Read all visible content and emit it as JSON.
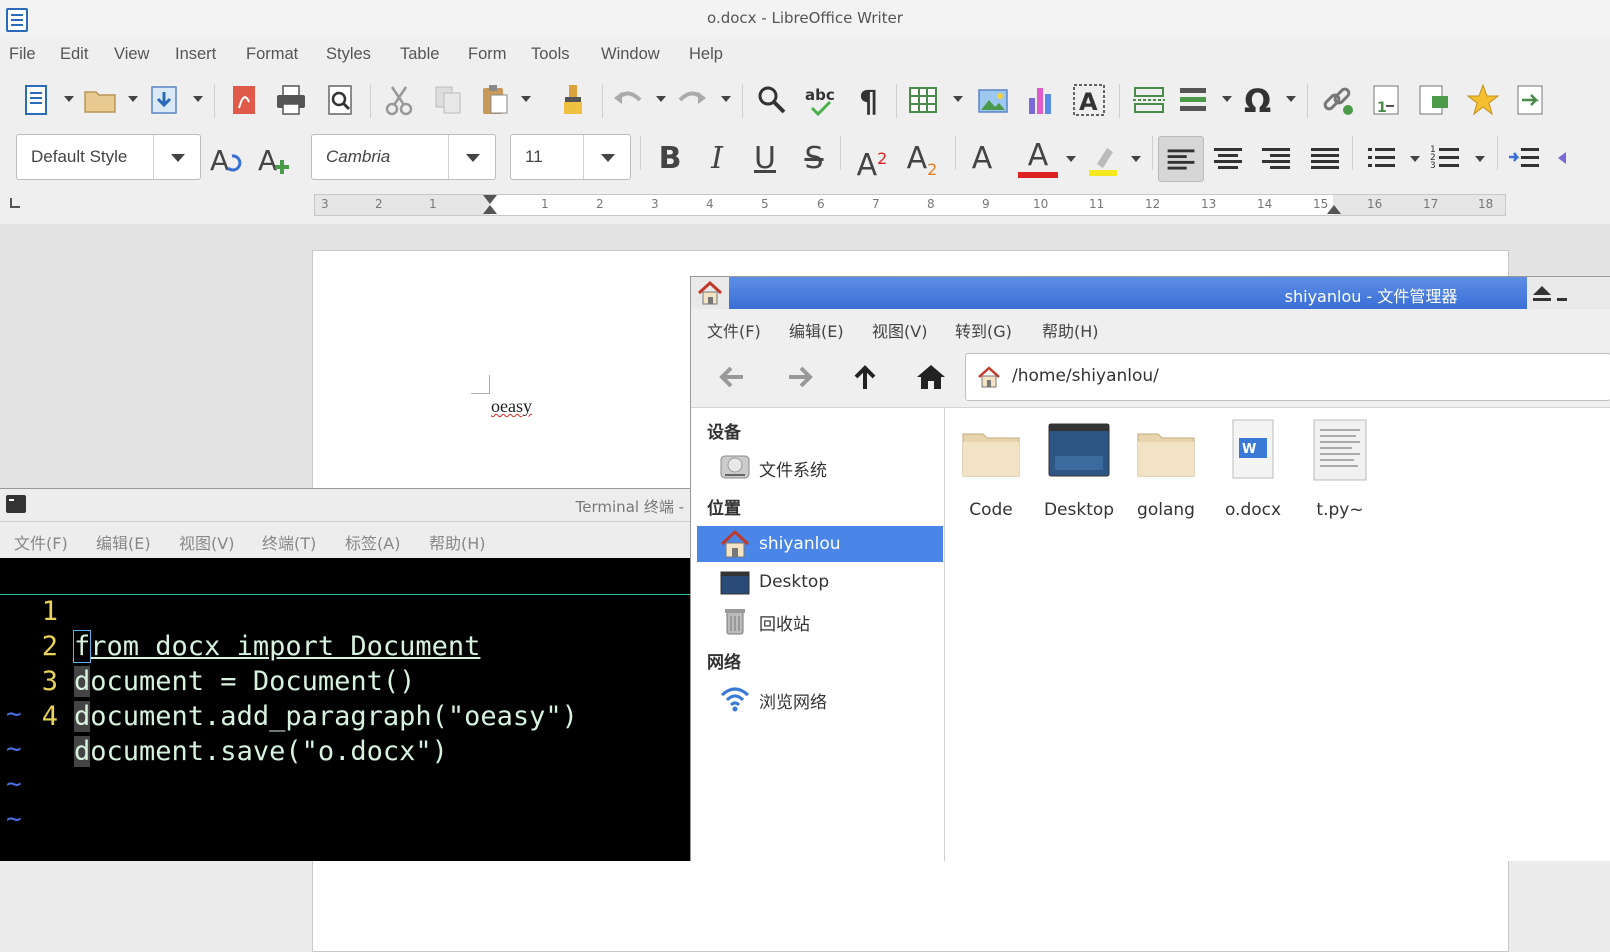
{
  "writer": {
    "title": "o.docx - LibreOffice Writer",
    "menu": [
      "File",
      "Edit",
      "View",
      "Insert",
      "Format",
      "Styles",
      "Table",
      "Form",
      "Tools",
      "Window",
      "Help"
    ],
    "paragraph_style": "Default Style",
    "font_name": "Cambria",
    "font_size": "11",
    "ruler_ticks": [
      "3",
      "2",
      "1",
      "1",
      "2",
      "3",
      "4",
      "5",
      "6",
      "7",
      "8",
      "9",
      "10",
      "11",
      "12",
      "13",
      "14",
      "15",
      "16",
      "17",
      "18"
    ],
    "document_text": "oeasy"
  },
  "terminal": {
    "title": "Terminal 终端 -",
    "menu": [
      "文件(F)",
      "编辑(E)",
      "视图(V)",
      "终端(T)",
      "标签(A)",
      "帮助(H)"
    ],
    "lines": [
      {
        "num": "1",
        "rest": "rom docx import Document",
        "first": "f"
      },
      {
        "num": "2",
        "rest": "ocument = Document()",
        "first": "d"
      },
      {
        "num": "3",
        "rest": "ocument.add_paragraph(\"oeasy\")",
        "first": "d"
      },
      {
        "num": "4",
        "rest": "ocument.save(\"o.docx\")",
        "first": "d"
      }
    ],
    "tilde": "~"
  },
  "file_manager": {
    "title": "shiyanlou - 文件管理器",
    "menu": [
      "文件(F)",
      "编辑(E)",
      "视图(V)",
      "转到(G)",
      "帮助(H)"
    ],
    "path": "/home/shiyanlou/",
    "sidebar": {
      "devices_header": "设备",
      "devices": [
        "文件系统"
      ],
      "places_header": "位置",
      "places": [
        "shiyanlou",
        "Desktop",
        "回收站"
      ],
      "network_header": "网络",
      "network": [
        "浏览网络"
      ]
    },
    "files": [
      {
        "name": "Code",
        "icon": "folder-icon"
      },
      {
        "name": "Desktop",
        "icon": "desktop-folder-icon"
      },
      {
        "name": "golang",
        "icon": "folder-icon"
      },
      {
        "name": "o.docx",
        "icon": "word-document-icon"
      },
      {
        "name": "t.py~",
        "icon": "text-file-icon"
      }
    ]
  },
  "colors": {
    "accent": "#4a86e8",
    "titlebar_fm": "#3a6fd6",
    "terminal_bg": "#000000",
    "line_numbers": "#e8d35a",
    "code": "#d8f2e0"
  }
}
